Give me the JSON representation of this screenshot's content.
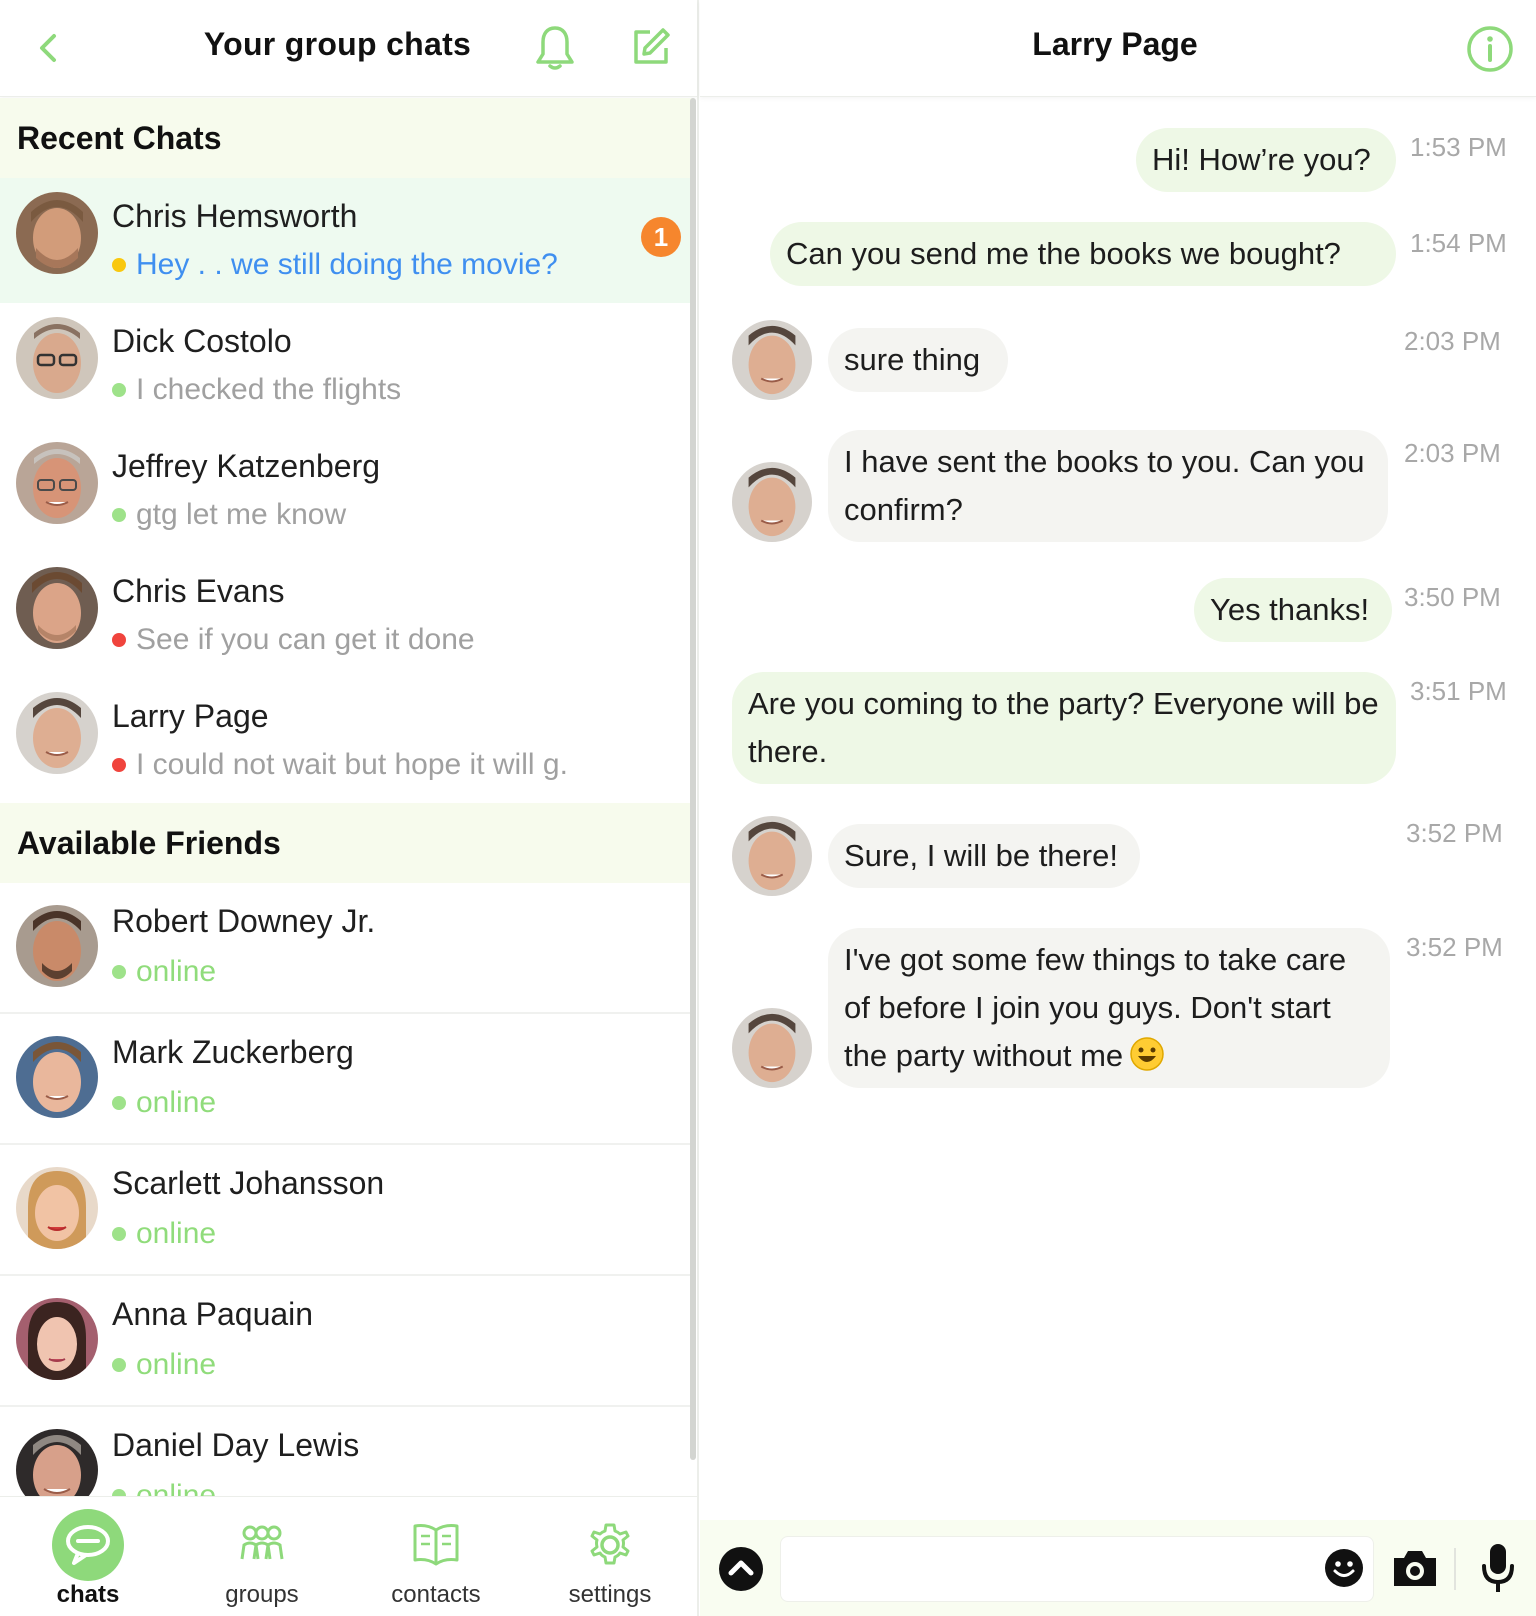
{
  "left_header": {
    "title": "Your group chats"
  },
  "recent": {
    "heading": "Recent Chats",
    "items": [
      {
        "name": "Chris Hemsworth",
        "preview": "Hey . . we still doing the movie?",
        "status_color": "#f9c80e",
        "badge": "1"
      },
      {
        "name": "Dick Costolo",
        "preview": "I checked the flights",
        "status_color": "#9ee28a"
      },
      {
        "name": "Jeffrey Katzenberg",
        "preview": "gtg let me know",
        "status_color": "#9ee28a"
      },
      {
        "name": "Chris Evans",
        "preview": "See if you can get it done",
        "status_color": "#f0443d"
      },
      {
        "name": "Larry Page",
        "preview": "I could not wait but hope it will g.",
        "status_color": "#f0443d"
      }
    ]
  },
  "friends": {
    "heading": "Available Friends",
    "items": [
      {
        "name": "Robert Downey Jr.",
        "status": "online"
      },
      {
        "name": "Mark Zuckerberg",
        "status": "online"
      },
      {
        "name": "Scarlett Johansson",
        "status": "online"
      },
      {
        "name": "Anna Paquain",
        "status": "online"
      },
      {
        "name": "Daniel Day Lewis",
        "status": "online"
      }
    ]
  },
  "tabs": [
    {
      "label": "chats",
      "icon": "chat-bubble-icon",
      "active": true
    },
    {
      "label": "groups",
      "icon": "groups-icon"
    },
    {
      "label": "contacts",
      "icon": "book-icon"
    },
    {
      "label": "settings",
      "icon": "gear-icon"
    }
  ],
  "conversation": {
    "title": "Larry Page",
    "messages": [
      {
        "dir": "out",
        "text": "Hi! How’re you?",
        "time": "1:53 PM"
      },
      {
        "dir": "out",
        "text": "Can you send me the books we bought?",
        "time": "1:54 PM"
      },
      {
        "dir": "in",
        "text": "sure thing",
        "time": "2:03 PM"
      },
      {
        "dir": "in",
        "text": "I have sent the books to you. Can you confirm?",
        "time": "2:03 PM"
      },
      {
        "dir": "out",
        "text": "Yes thanks!",
        "time": "3:50 PM"
      },
      {
        "dir": "out",
        "text": "Are you coming to the party? Everyone will be there.",
        "time": "3:51 PM"
      },
      {
        "dir": "in",
        "text": "Sure, I will be there!",
        "time": "3:52 PM"
      },
      {
        "dir": "in",
        "text": "I've got some few things to take care of before I join you guys. Don't start the party without me",
        "time": "3:52 PM"
      }
    ]
  },
  "composer": {
    "placeholder": ""
  },
  "colors": {
    "accent": "#8ed97b",
    "online": "#90dc7b",
    "badge": "#f6862d",
    "unread_text": "#3f8ff0"
  }
}
